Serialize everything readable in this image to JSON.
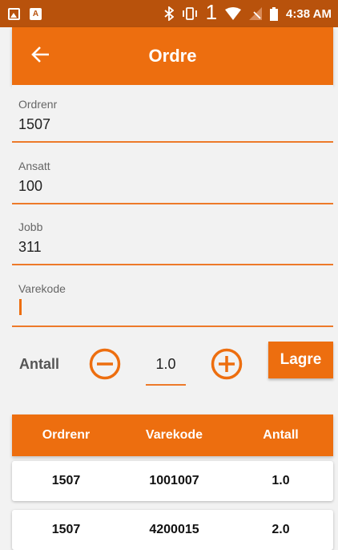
{
  "status_bar": {
    "time": "4:38 AM",
    "sim_number": "1"
  },
  "app_bar": {
    "title": "Ordre"
  },
  "form": {
    "ordrenr": {
      "label": "Ordrenr",
      "value": "1507"
    },
    "ansatt": {
      "label": "Ansatt",
      "value": "100"
    },
    "jobb": {
      "label": "Jobb",
      "value": "311"
    },
    "varekode": {
      "label": "Varekode",
      "value": ""
    }
  },
  "quantity": {
    "label": "Antall",
    "value": "1.0",
    "save_label": "Lagre"
  },
  "table": {
    "headers": [
      "Ordrenr",
      "Varekode",
      "Antall"
    ],
    "rows": [
      [
        "1507",
        "1001007",
        "1.0"
      ],
      [
        "1507",
        "4200015",
        "2.0"
      ]
    ]
  },
  "colors": {
    "accent": "#ed6e0f",
    "status_bar": "#b8520c",
    "background": "#f2f2f2"
  },
  "icons": [
    "image-icon",
    "a-icon",
    "bluetooth-icon",
    "vibrate-icon",
    "wifi-icon",
    "no-signal-icon",
    "battery-icon",
    "back-arrow-icon",
    "minus-circle-icon",
    "plus-circle-icon"
  ]
}
